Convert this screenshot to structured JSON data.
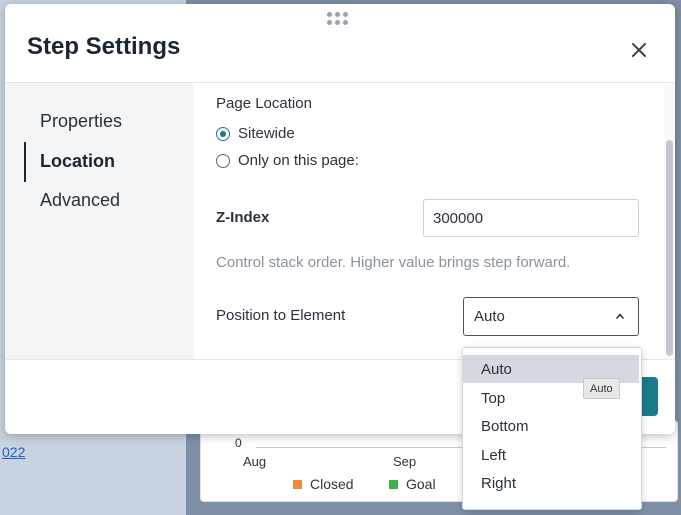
{
  "background": {
    "link_text": "022",
    "chart": {
      "zero_label": "0",
      "ticks": [
        "Aug",
        "Sep"
      ],
      "legend": [
        {
          "label": "Closed",
          "color": "#f08a3c"
        },
        {
          "label": "Goal",
          "color": "#3cb44b"
        }
      ]
    }
  },
  "modal": {
    "title": "Step Settings",
    "nav": {
      "items": [
        {
          "label": "Properties",
          "active": false
        },
        {
          "label": "Location",
          "active": true
        },
        {
          "label": "Advanced",
          "active": false
        }
      ]
    },
    "page_location": {
      "label": "Page Location",
      "options": [
        {
          "label": "Sitewide",
          "checked": true
        },
        {
          "label": "Only on this page:",
          "checked": false
        }
      ]
    },
    "z_index": {
      "label": "Z-Index",
      "value": "300000",
      "help": "Control stack order. Higher value brings step forward."
    },
    "position": {
      "label": "Position to Element",
      "selected": "Auto",
      "options": [
        "Auto",
        "Top",
        "Bottom",
        "Left",
        "Right"
      ],
      "tooltip": "Auto"
    },
    "accent_color": "#1b7a8b"
  }
}
